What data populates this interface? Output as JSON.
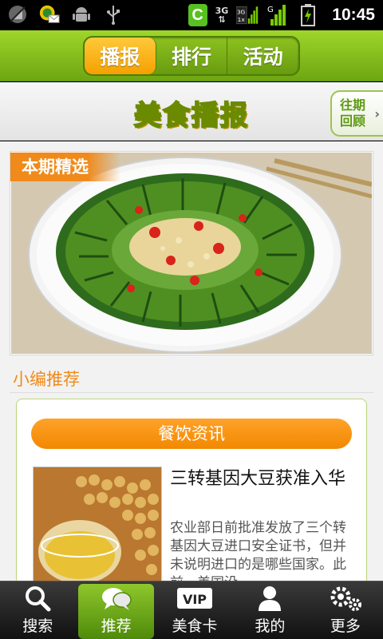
{
  "status_bar": {
    "time": "10:45",
    "net_3g": "3G",
    "net_3g_small": "3G",
    "net_1x": "1x",
    "net_g": "G"
  },
  "top_tabs": [
    {
      "label": "播报",
      "active": true
    },
    {
      "label": "排行",
      "active": false
    },
    {
      "label": "活动",
      "active": false
    }
  ],
  "header": {
    "title": "美食播报",
    "past_label_line1": "往期",
    "past_label_line2": "回顾"
  },
  "hero": {
    "badge": "本期精选"
  },
  "recommend": {
    "heading": "小编推荐",
    "category": "餐饮资讯",
    "article_title": "三转基因大豆获准入华",
    "article_summary": "农业部日前批准发放了三个转基因大豆进口安全证书，但并未说明进口的是哪些国家。此前，美国没"
  },
  "bottom_nav": [
    {
      "label": "搜索",
      "icon": "search-icon",
      "active": false
    },
    {
      "label": "推荐",
      "icon": "chat-bubbles-icon",
      "active": true
    },
    {
      "label": "美食卡",
      "icon": "vip-card-icon",
      "active": false
    },
    {
      "label": "我的",
      "icon": "person-icon",
      "active": false
    },
    {
      "label": "更多",
      "icon": "gears-icon",
      "active": false
    }
  ],
  "bottom_nav_vip_text": "VIP",
  "colors": {
    "brand_green": "#7fb81a",
    "accent_orange": "#f08a1a",
    "tab_active": "#f5a000"
  }
}
